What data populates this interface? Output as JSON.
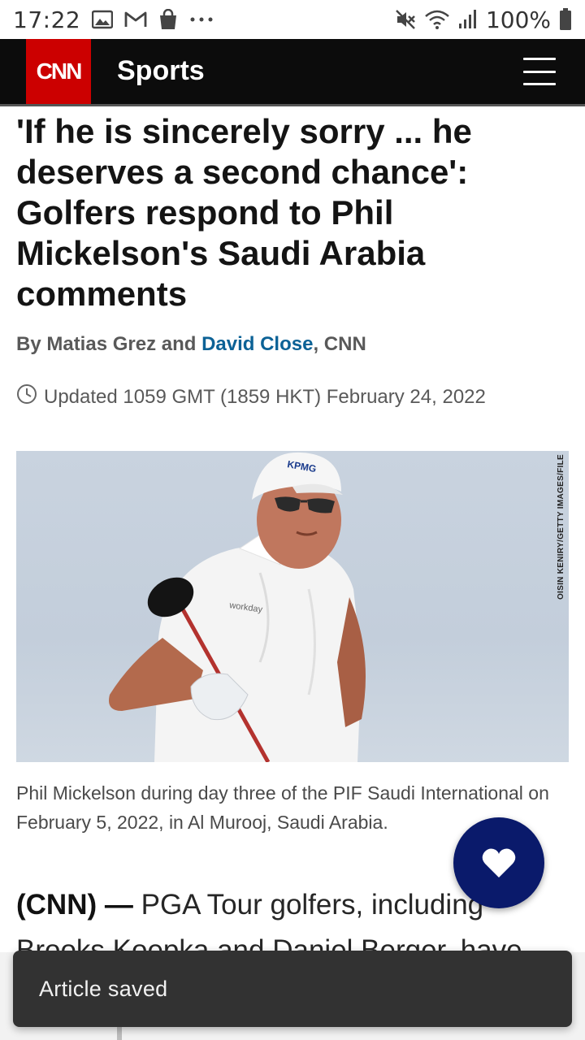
{
  "status_bar": {
    "time": "17:22",
    "battery_text": "100%",
    "left_icons": [
      "gallery-icon",
      "gmail-icon",
      "shopping-bag-icon",
      "more-dots-icon"
    ],
    "right_icons": [
      "mute-icon",
      "wifi-icon",
      "signal-icon",
      "battery-icon"
    ]
  },
  "navbar": {
    "logo_text": "CNN",
    "section_title": "Sports",
    "colors": {
      "background": "#0c0c0c",
      "logo_red": "#cc0000"
    }
  },
  "article": {
    "headline": "'If he is sincerely sorry ... he deserves a second chance': Golfers respond to Phil Mickelson's Saudi Arabia comments",
    "byline": {
      "prefix": "By Matias Grez and ",
      "author_link": "David Close",
      "suffix": ", CNN"
    },
    "updated": "Updated 1059 GMT (1859 HKT) February 24, 2022",
    "photo_credit": "OISIN KENIRY/GETTY IMAGES/FILE",
    "photo_logos": {
      "cap": "KPMG",
      "shirt": "workday"
    },
    "caption": "Phil Mickelson during day three of the PIF Saudi International on February 5, 2022, in Al Murooj, Saudi Arabia.",
    "body": {
      "dateline": "(CNN) — ",
      "text": "PGA Tour golfers, including Brooks Koepka and Daniel Berger, have"
    }
  },
  "fab": {
    "icon": "heart-icon",
    "color": "#0a1a6b"
  },
  "snackbar": {
    "message": "Article saved"
  }
}
